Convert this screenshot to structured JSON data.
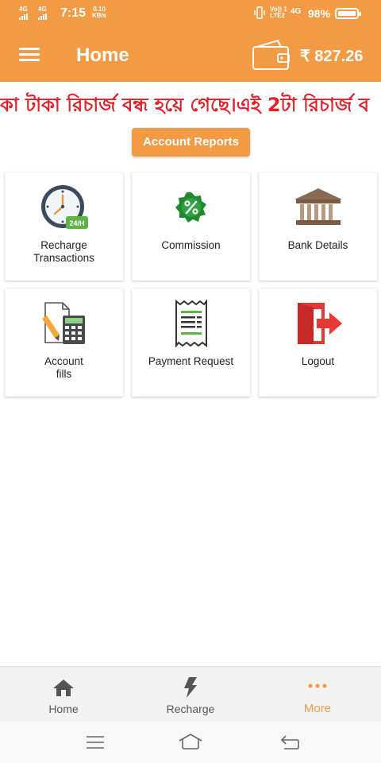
{
  "status_bar": {
    "sim1": "4G",
    "sim2": "4G",
    "time": "7:15",
    "speed_value": "0.10",
    "speed_unit": "KB/s",
    "volte_top": "Vo)) 1",
    "volte_bottom": "LTE2",
    "network": "4G",
    "battery": "98%",
    "battery_level": 0.98
  },
  "app_bar": {
    "title": "Home",
    "balance": "₹ 827.26"
  },
  "marquee": {
    "text": "কা টাকা রিচার্জ বন্ধ হয়ে গেছে।এই 2টা রিচার্জ ব"
  },
  "reports_button": "Account Reports",
  "tiles": [
    {
      "label_line1": "Recharge",
      "label_line2": "Transactions",
      "icon": "clock-24h-icon"
    },
    {
      "label_line1": "Commission",
      "label_line2": "",
      "icon": "percent-badge-icon"
    },
    {
      "label_line1": "Bank Details",
      "label_line2": "",
      "icon": "bank-icon"
    },
    {
      "label_line1": "Account",
      "label_line2": "fills",
      "icon": "calculator-document-icon"
    },
    {
      "label_line1": "Payment Request",
      "label_line2": "",
      "icon": "receipt-icon"
    },
    {
      "label_line1": "Logout",
      "label_line2": "",
      "icon": "logout-door-icon"
    }
  ],
  "clock_badge": "24/H",
  "bottom_nav": [
    {
      "label": "Home",
      "icon": "home-icon"
    },
    {
      "label": "Recharge",
      "icon": "lightning-icon"
    },
    {
      "label": "More",
      "icon": "more-dots-icon"
    }
  ],
  "active_tab": "More",
  "colors": {
    "primary": "#f39a45",
    "marquee_text": "#e0202b",
    "active_tab": "#f39a45"
  }
}
